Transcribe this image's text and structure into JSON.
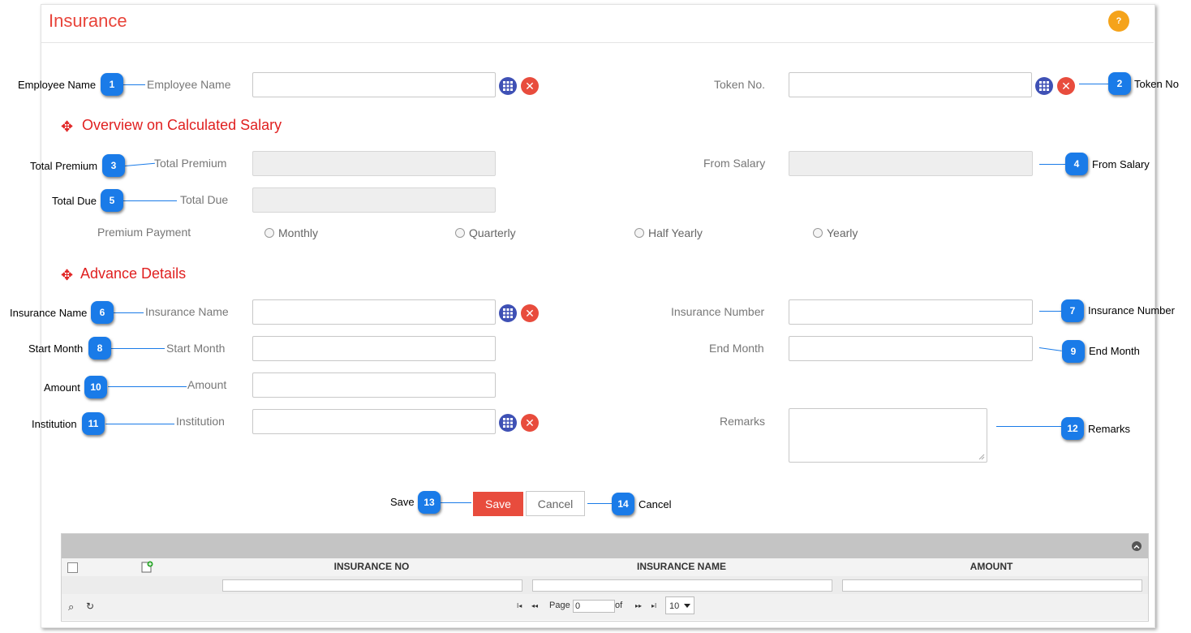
{
  "page": {
    "title": "Insurance",
    "help_label": "?"
  },
  "form": {
    "employee_name_label": "Employee Name",
    "token_no_label": "Token No.",
    "section_overview": "Overview on Calculated Salary",
    "total_premium_label": "Total Premium",
    "from_salary_label": "From Salary",
    "total_due_label": "Total Due",
    "premium_payment_label": "Premium Payment",
    "payment_options": [
      "Monthly",
      "Quarterly",
      "Half Yearly",
      "Yearly"
    ],
    "section_advance": "Advance Details",
    "insurance_name_label": "Insurance Name",
    "insurance_number_label": "Insurance Number",
    "start_month_label": "Start Month",
    "end_month_label": "End Month",
    "amount_label": "Amount",
    "institution_label": "Institution",
    "remarks_label": "Remarks",
    "clear_symbol": "✕",
    "section_symbol": "✥"
  },
  "buttons": {
    "save": "Save",
    "cancel": "Cancel"
  },
  "callouts": [
    {
      "num": "1",
      "label": "Employee Name"
    },
    {
      "num": "2",
      "label": "Token No"
    },
    {
      "num": "3",
      "label": "Total Premium"
    },
    {
      "num": "4",
      "label": "From Salary"
    },
    {
      "num": "5",
      "label": "Total Due"
    },
    {
      "num": "6",
      "label": "Insurance Name"
    },
    {
      "num": "7",
      "label": "Insurance Number"
    },
    {
      "num": "8",
      "label": "Start Month"
    },
    {
      "num": "9",
      "label": "End Month"
    },
    {
      "num": "10",
      "label": "Amount"
    },
    {
      "num": "11",
      "label": "Institution"
    },
    {
      "num": "12",
      "label": "Remarks"
    },
    {
      "num": "13",
      "label": "Save"
    },
    {
      "num": "14",
      "label": "Cancel"
    }
  ],
  "grid": {
    "columns": [
      "INSURANCE NO",
      "INSURANCE NAME",
      "AMOUNT"
    ],
    "pager": {
      "page_label": "Page",
      "page_value": "0",
      "of_label": "of",
      "page_size": "10",
      "first": "I◂",
      "prev": "◂◂",
      "next": "▸▸",
      "last": "▸I",
      "search_icon": "⌕",
      "refresh_icon": "↻"
    },
    "add_icon": "🗎"
  },
  "colors": {
    "accent_red": "#e84c3d",
    "callout_blue": "#1a7be8",
    "icon_indigo": "#3f51b5",
    "help_orange": "#f5a31a"
  }
}
